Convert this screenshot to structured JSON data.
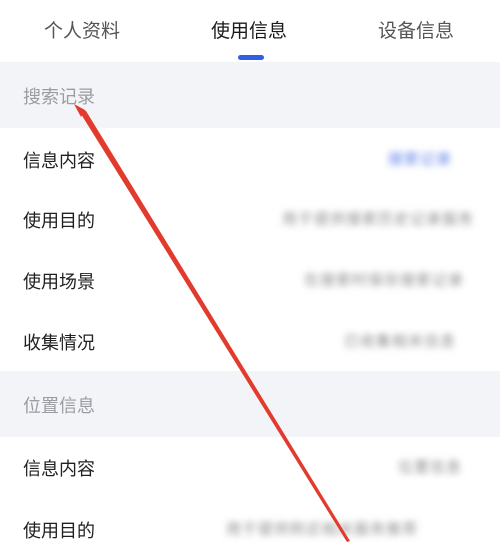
{
  "tabs": [
    {
      "label": "个人资料"
    },
    {
      "label": "使用信息"
    },
    {
      "label": "设备信息"
    }
  ],
  "sections": [
    {
      "title": "搜索记录",
      "rows": [
        {
          "label": "信息内容",
          "value": "搜索记录"
        },
        {
          "label": "使用目的",
          "value": "用于提供搜索历史记录服务"
        },
        {
          "label": "使用场景",
          "value": "在搜索时保存搜索记录"
        },
        {
          "label": "收集情况",
          "value": "已收集相关信息"
        }
      ]
    },
    {
      "title": "位置信息",
      "rows": [
        {
          "label": "信息内容",
          "value": "位置信息"
        },
        {
          "label": "使用目的",
          "value": "用于提供附近相关服务推荐"
        }
      ]
    }
  ],
  "colors": {
    "accent": "#2f5fe6",
    "annotation_arrow": "#e23b2e",
    "section_bg": "#f3f4f7"
  }
}
